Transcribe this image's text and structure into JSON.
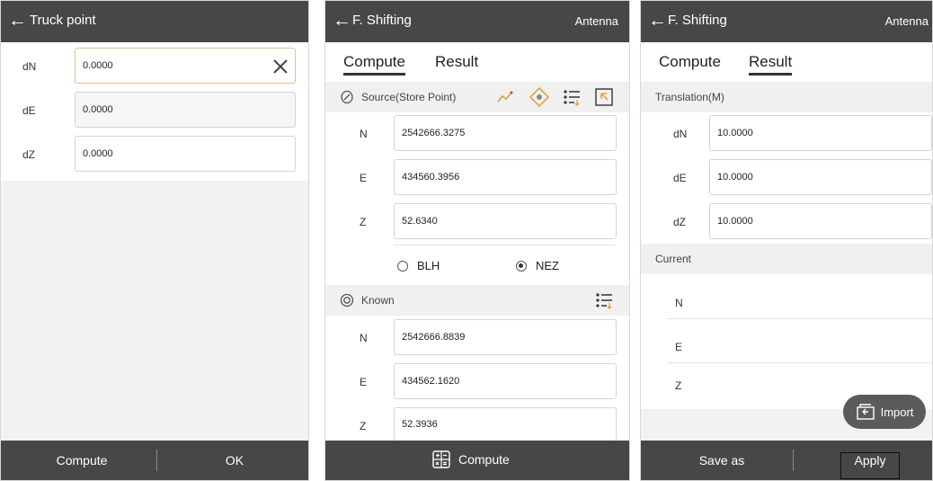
{
  "panel1": {
    "title": "Truck point",
    "fields": [
      {
        "label": "dN",
        "value": "0.0000"
      },
      {
        "label": "dE",
        "value": "0.0000"
      },
      {
        "label": "dZ",
        "value": "0.0000"
      }
    ],
    "footer": {
      "compute": "Compute",
      "ok": "OK"
    }
  },
  "panel2": {
    "title": "F. Shifting",
    "right": "Antenna",
    "tabs": [
      "Compute",
      "Result"
    ],
    "source": {
      "title": "Source(Store Point)",
      "fields": [
        {
          "label": "N",
          "value": "2542666.3275"
        },
        {
          "label": "E",
          "value": "434560.3956"
        },
        {
          "label": "Z",
          "value": "52.6340"
        }
      ]
    },
    "radio": {
      "blh": "BLH",
      "nez": "NEZ",
      "selected": "NEZ"
    },
    "known": {
      "title": "Known",
      "fields": [
        {
          "label": "N",
          "value": "2542666.8839"
        },
        {
          "label": "E",
          "value": "434562.1620"
        },
        {
          "label": "Z",
          "value": "52.3936"
        }
      ]
    },
    "footer": {
      "compute": "Compute"
    }
  },
  "panel3": {
    "title": "F. Shifting",
    "right": "Antenna",
    "tabs": [
      "Compute",
      "Result"
    ],
    "translation": {
      "title": "Translation(M)",
      "fields": [
        {
          "label": "dN",
          "value": "10.0000"
        },
        {
          "label": "dE",
          "value": "10.0000"
        },
        {
          "label": "dZ",
          "value": "10.0000"
        }
      ]
    },
    "current": {
      "title": "Current",
      "labels": [
        "N",
        "E",
        "Z"
      ]
    },
    "import": "Import",
    "footer": {
      "save_as": "Save as",
      "apply": "Apply"
    }
  },
  "colors": {
    "header": "#474747",
    "focus_border": "#e2c08a"
  }
}
